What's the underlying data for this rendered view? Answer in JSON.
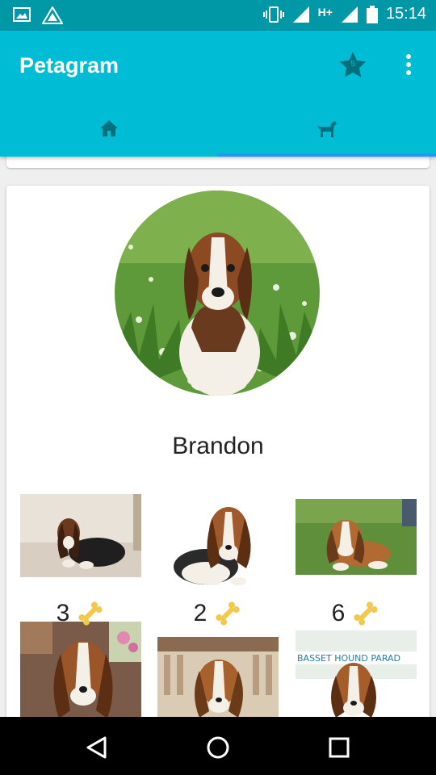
{
  "status_bar": {
    "time": "15:14",
    "network_label": "H+",
    "icons": [
      "gallery-icon",
      "app-notification-icon",
      "vibrate-icon",
      "signal-icon",
      "signal-icon",
      "battery-icon"
    ]
  },
  "app_bar": {
    "title": "Petagram",
    "favorites_count": "5",
    "actions": [
      "star-icon",
      "overflow-menu-icon"
    ]
  },
  "tabs": [
    {
      "icon": "home-icon",
      "selected": false
    },
    {
      "icon": "dog-icon",
      "selected": true
    }
  ],
  "colors": {
    "primary": "#00bcd4",
    "primary_dark": "#0097a7",
    "tab_indicator": "#2196f3",
    "tab_icon": "#00707d"
  },
  "profile": {
    "name": "Brandon"
  },
  "photos": [
    {
      "likes": "3",
      "icon": "bone-icon"
    },
    {
      "likes": "2",
      "icon": "bone-icon"
    },
    {
      "likes": "6",
      "icon": "bone-icon"
    },
    {
      "likes": "",
      "icon": ""
    },
    {
      "likes": "",
      "icon": ""
    },
    {
      "likes": "",
      "icon": ""
    }
  ],
  "photo_sign_text": "BASSET HOUND PARAD",
  "nav_bar": [
    "back-icon",
    "home-circle-icon",
    "recents-icon"
  ]
}
